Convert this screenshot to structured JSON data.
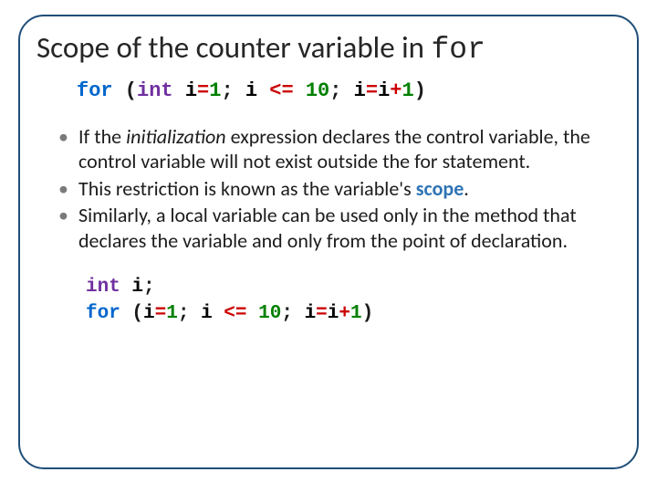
{
  "title": {
    "prefix": "Scope of the counter variable in ",
    "mono": "for"
  },
  "code1": {
    "for": "for",
    "open": " (",
    "int": "int",
    "sp1": " ",
    "id1": "i",
    "eq1": "=",
    "n1": "1",
    "semi1": "; ",
    "id2": "i ",
    "le": "<=",
    "sp2": " ",
    "n10": "10",
    "semi2": "; ",
    "id3": "i",
    "eq2": "=",
    "id4": "i",
    "plus": "+",
    "n1b": "1",
    "close": ")"
  },
  "bullets": {
    "b1_prefix": "If the ",
    "b1_italic": "initialization",
    "b1_rest": " expression declares the control variable, the control variable will not exist outside the for statement.",
    "b2_prefix": "This restriction is known as the variable's ",
    "b2_scope": "scope",
    "b2_suffix": ".",
    "b3": "Similarly, a local variable can be used only in the method that declares the variable and only from the point of declaration."
  },
  "code2": {
    "line1": {
      "int": "int",
      "sp": " ",
      "id": "i",
      "semi": ";"
    },
    "line2": {
      "for": "for",
      "open": " (",
      "id1": "i",
      "eq1": "=",
      "n1": "1",
      "semi1": "; ",
      "id2": "i ",
      "le": "<=",
      "sp2": " ",
      "n10": "10",
      "semi2": "; ",
      "id3": "i",
      "eq2": "=",
      "id4": "i",
      "plus": "+",
      "n1b": "1",
      "close": ")"
    }
  }
}
